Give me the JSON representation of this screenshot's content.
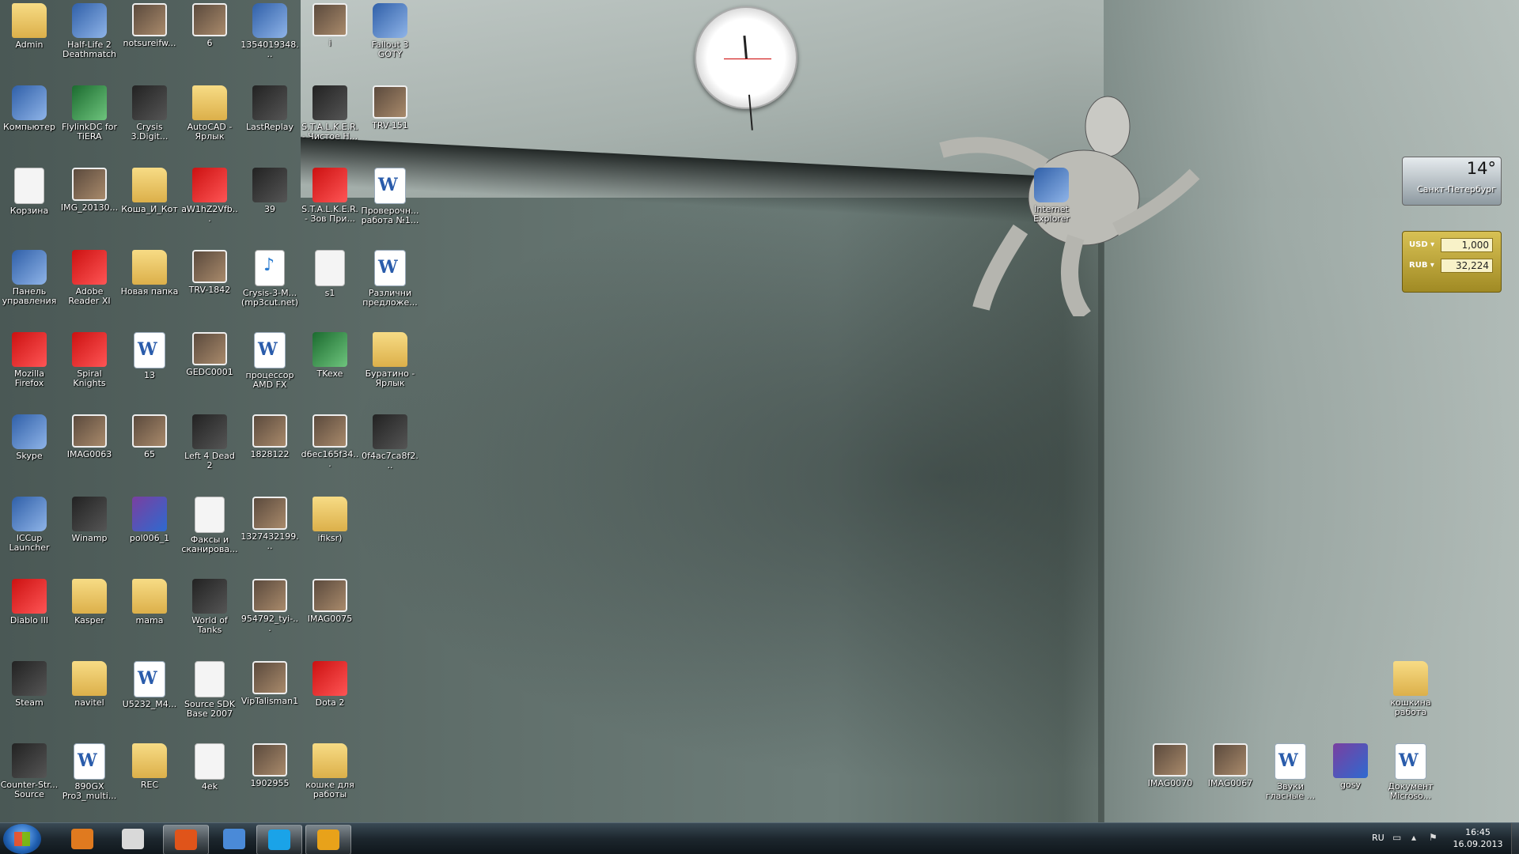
{
  "desktop": {
    "icons": [
      {
        "label": "Admin",
        "type": "folder"
      },
      {
        "label": "Half-Life 2 Deathmatch",
        "type": "app"
      },
      {
        "label": "notsureifw...",
        "type": "photo"
      },
      {
        "label": "6",
        "type": "photo"
      },
      {
        "label": "1354019348...",
        "type": "app"
      },
      {
        "label": "i",
        "type": "photo"
      },
      {
        "label": "Fallout 3 GOTY",
        "type": "app"
      },
      {
        "label": "Компьютер",
        "type": "app"
      },
      {
        "label": "FlylinkDC for TiERA",
        "type": "green"
      },
      {
        "label": "Crysis 3.Digit...",
        "type": "dark"
      },
      {
        "label": "AutoCAD - Ярлык",
        "type": "folder"
      },
      {
        "label": "LastReplay",
        "type": "dark"
      },
      {
        "label": "S.T.A.L.K.E.R. - Чистое Н...",
        "type": "dark"
      },
      {
        "label": "TRV-151",
        "type": "photo"
      },
      {
        "label": "Корзина",
        "type": "blank"
      },
      {
        "label": "IMG_20130...",
        "type": "photo"
      },
      {
        "label": "Коша_И_Кот",
        "type": "folder"
      },
      {
        "label": "aW1hZ2Vfb...",
        "type": "red"
      },
      {
        "label": "39",
        "type": "dark"
      },
      {
        "label": "S.T.A.L.K.E.R. - Зов При...",
        "type": "red"
      },
      {
        "label": "Проверочн... работа №1...",
        "type": "word"
      },
      {
        "label": "Панель управления",
        "type": "app"
      },
      {
        "label": "Adobe Reader XI",
        "type": "red"
      },
      {
        "label": "Новая папка",
        "type": "folder"
      },
      {
        "label": "TRV-1842",
        "type": "photo"
      },
      {
        "label": "Crysis-3-M... (mp3cut.net)",
        "type": "mp3"
      },
      {
        "label": "s1",
        "type": "blank"
      },
      {
        "label": "Различни предложе...",
        "type": "word"
      },
      {
        "label": "Mozilla Firefox",
        "type": "red"
      },
      {
        "label": "Spiral Knights",
        "type": "red"
      },
      {
        "label": "13",
        "type": "word"
      },
      {
        "label": "GEDC0001",
        "type": "photo"
      },
      {
        "label": "процессор AMD FX",
        "type": "word"
      },
      {
        "label": "TKexe",
        "type": "green"
      },
      {
        "label": "Буратино - Ярлык",
        "type": "folder"
      },
      {
        "label": "Skype",
        "type": "app"
      },
      {
        "label": "IMAG0063",
        "type": "photo"
      },
      {
        "label": "65",
        "type": "photo"
      },
      {
        "label": "Left 4 Dead 2",
        "type": "dark"
      },
      {
        "label": "1828122",
        "type": "photo"
      },
      {
        "label": "d6ec165f34...",
        "type": "photo"
      },
      {
        "label": "0f4ac7ca8f2...",
        "type": "dark"
      },
      {
        "label": "ICCup Launcher",
        "type": "app"
      },
      {
        "label": "Winamp",
        "type": "dark"
      },
      {
        "label": "pol006_1",
        "type": "rar"
      },
      {
        "label": "Факсы и сканирова...",
        "type": "blank"
      },
      {
        "label": "1327432199...",
        "type": "photo"
      },
      {
        "label": "ifiksr)",
        "type": "folder"
      },
      {
        "label": "Diablo III",
        "type": "red"
      },
      {
        "label": "Kasper",
        "type": "folder"
      },
      {
        "label": "mama",
        "type": "folder"
      },
      {
        "label": "World of Tanks",
        "type": "dark"
      },
      {
        "label": "954792_tyi-...",
        "type": "photo"
      },
      {
        "label": "IMAG0075",
        "type": "photo"
      },
      {
        "label": "Steam",
        "type": "dark"
      },
      {
        "label": "navitel",
        "type": "folder"
      },
      {
        "label": "U5232_M4...",
        "type": "word"
      },
      {
        "label": "Source SDK Base 2007",
        "type": "blank"
      },
      {
        "label": "VipTalisman1",
        "type": "photo"
      },
      {
        "label": "Dota 2",
        "type": "red"
      },
      {
        "label": "Counter-Str... Source",
        "type": "dark"
      },
      {
        "label": "890GX Pro3_multi...",
        "type": "word"
      },
      {
        "label": "REC",
        "type": "folder"
      },
      {
        "label": "4ek",
        "type": "blank"
      },
      {
        "label": "1902955",
        "type": "photo"
      },
      {
        "label": "кошке для работы",
        "type": "folder"
      },
      {
        "label": "Internet Explorer",
        "type": "app"
      },
      {
        "label": "кошкина работа",
        "type": "folder"
      },
      {
        "label": "IMAG0070",
        "type": "photo"
      },
      {
        "label": "IMAG0067",
        "type": "photo"
      },
      {
        "label": "Звуки гласные ...",
        "type": "word"
      },
      {
        "label": "gosy",
        "type": "rar"
      },
      {
        "label": "Документ Microso...",
        "type": "word"
      }
    ]
  },
  "gadgets": {
    "weather": {
      "temp": "14°",
      "city": "Санкт-Петербург"
    },
    "currency": {
      "rows": [
        {
          "name": "USD ▾",
          "value": "1,000"
        },
        {
          "name": "RUB ▾",
          "value": "32,224"
        }
      ]
    }
  },
  "taskbar": {
    "pinned": [
      {
        "name": "media-player-icon",
        "color": "#e07a1f",
        "active": false
      },
      {
        "name": "video-editor-icon",
        "color": "#d9d9d9",
        "active": false
      },
      {
        "name": "firefox-icon",
        "color": "#e0541a",
        "active": true
      },
      {
        "name": "control-panel-icon",
        "color": "#4a8ad8",
        "active": false
      },
      {
        "name": "skype-icon",
        "color": "#1aa3e8",
        "active": true
      },
      {
        "name": "winamp-icon",
        "color": "#e8a21a",
        "active": true
      }
    ],
    "tray": {
      "lang": "RU",
      "time": "16:45",
      "date": "16.09.2013"
    }
  }
}
